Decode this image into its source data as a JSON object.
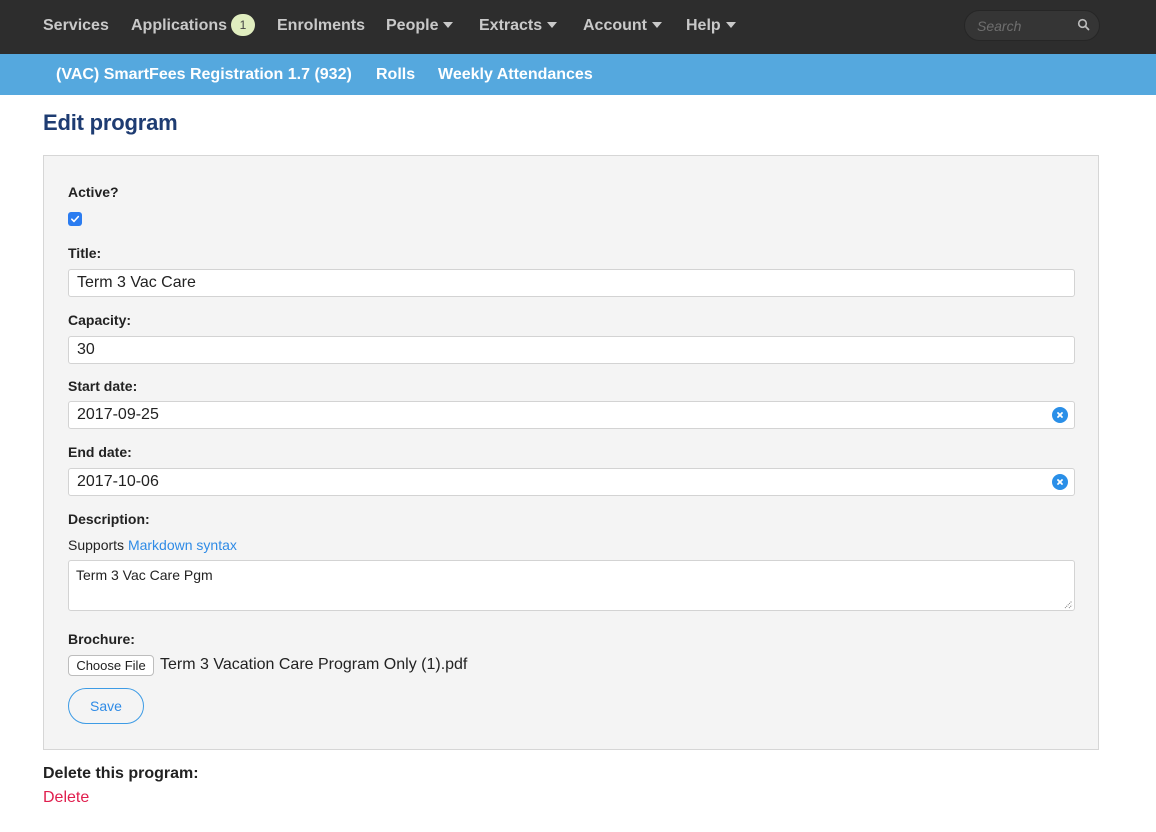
{
  "topnav": {
    "items": [
      {
        "label": "Services",
        "dropdown": false
      },
      {
        "label": "Applications",
        "badge": "1",
        "dropdown": false
      },
      {
        "label": "Enrolments",
        "dropdown": false
      },
      {
        "label": "People",
        "dropdown": true
      },
      {
        "label": "Extracts",
        "dropdown": true
      },
      {
        "label": "Account",
        "dropdown": true
      },
      {
        "label": "Help",
        "dropdown": true
      }
    ],
    "search": {
      "placeholder": "Search",
      "value": "",
      "icon": "search-icon"
    }
  },
  "subnav": {
    "items": [
      {
        "label": "(VAC) SmartFees Registration 1.7 (932)"
      },
      {
        "label": "Rolls"
      },
      {
        "label": "Weekly Attendances"
      }
    ]
  },
  "page": {
    "title": "Edit program"
  },
  "form": {
    "active": {
      "label": "Active?",
      "checked": true
    },
    "title": {
      "label": "Title:",
      "value": "Term 3 Vac Care"
    },
    "capacity": {
      "label": "Capacity:",
      "value": "30"
    },
    "start_date": {
      "label": "Start date:",
      "value": "2017-09-25",
      "clear_icon": "clear-icon"
    },
    "end_date": {
      "label": "End date:",
      "value": "2017-10-06",
      "clear_icon": "clear-icon"
    },
    "description": {
      "label": "Description:",
      "help_prefix": "Supports",
      "help_link": "Markdown syntax",
      "value": "Term 3 Vac Care Pgm"
    },
    "brochure": {
      "label": "Brochure:",
      "button_label": "Choose File",
      "file_name": "Term 3 Vacation Care Program Only (1).pdf"
    },
    "save_label": "Save"
  },
  "delete_section": {
    "heading": "Delete this program:",
    "link_label": "Delete"
  },
  "colors": {
    "topnav_bg": "#2d2d2d",
    "subnav_bg": "#55a8de",
    "title": "#1e3c72",
    "link": "#2f8be6",
    "danger": "#e01e4d",
    "badge_bg": "#e0edbf"
  }
}
